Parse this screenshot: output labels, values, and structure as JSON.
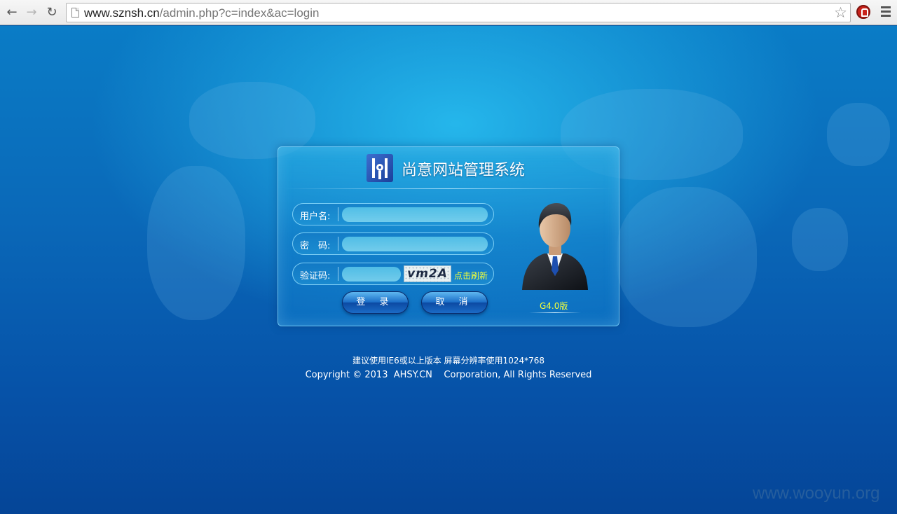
{
  "browser": {
    "url_host": "www.sznsh.cn",
    "url_path": "/admin.php?c=index&ac=login"
  },
  "login": {
    "title": "尚意网站管理系统",
    "username_label": "用户名:",
    "password_label": "密　码:",
    "captcha_label": "验证码:",
    "captcha_text": "vm2A",
    "refresh_label": "点击刷新",
    "login_button": "登 录",
    "cancel_button": "取 消",
    "version": "G4.0版"
  },
  "footer": {
    "recommendation": "建议使用IE6或以上版本 屏幕分辨率使用1024*768",
    "copyright": "Copyright © 2013  AHSY.CN    Corporation, All Rights Reserved"
  },
  "watermark": "www.wooyun.org"
}
